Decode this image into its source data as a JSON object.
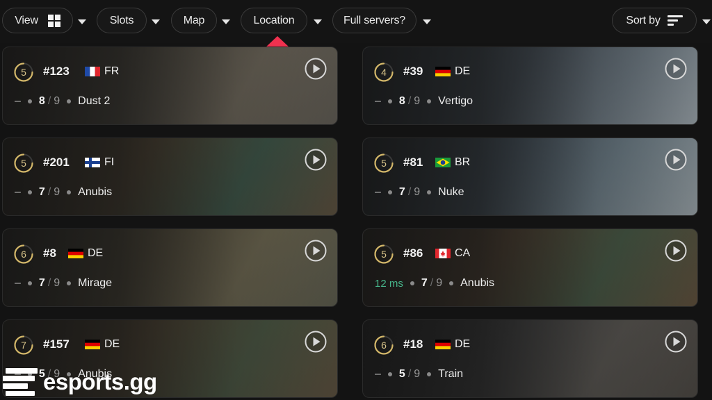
{
  "filters": {
    "view": {
      "label": "View",
      "icon": "grid-icon"
    },
    "slots": {
      "label": "Slots"
    },
    "map": {
      "label": "Map"
    },
    "location": {
      "label": "Location"
    },
    "full_servers": {
      "label": "Full servers?"
    },
    "sort_by": {
      "label": "Sort by",
      "icon": "sort-lines-icon"
    },
    "dropdown_icon": "caret-down-icon"
  },
  "annotation": {
    "icon": "red-arrow-up-icon",
    "color": "#f0314f"
  },
  "servers": [
    {
      "level": "5",
      "id": "#123",
      "flag": "fr",
      "country": "FR",
      "ping": "–",
      "players": "8",
      "max": "9",
      "map": "Dust 2"
    },
    {
      "level": "4",
      "id": "#39",
      "flag": "de",
      "country": "DE",
      "ping": "–",
      "players": "8",
      "max": "9",
      "map": "Vertigo"
    },
    {
      "level": "5",
      "id": "#201",
      "flag": "fi",
      "country": "FI",
      "ping": "–",
      "players": "7",
      "max": "9",
      "map": "Anubis"
    },
    {
      "level": "5",
      "id": "#81",
      "flag": "br",
      "country": "BR",
      "ping": "–",
      "players": "7",
      "max": "9",
      "map": "Nuke"
    },
    {
      "level": "6",
      "id": "#8",
      "flag": "de",
      "country": "DE",
      "ping": "–",
      "players": "7",
      "max": "9",
      "map": "Mirage"
    },
    {
      "level": "5",
      "id": "#86",
      "flag": "ca",
      "country": "CA",
      "ping": "12 ms",
      "players": "7",
      "max": "9",
      "map": "Anubis"
    },
    {
      "level": "7",
      "id": "#157",
      "flag": "de",
      "country": "DE",
      "ping": "–",
      "players": "5",
      "max": "9",
      "map": "Anubis"
    },
    {
      "level": "6",
      "id": "#18",
      "flag": "de",
      "country": "DE",
      "ping": "–",
      "players": "5",
      "max": "9",
      "map": "Train"
    }
  ],
  "colors": {
    "level_ring": "#d4b86a",
    "ping_good": "#47b58b",
    "background": "#131313"
  },
  "watermark": {
    "text": "esports.gg"
  }
}
